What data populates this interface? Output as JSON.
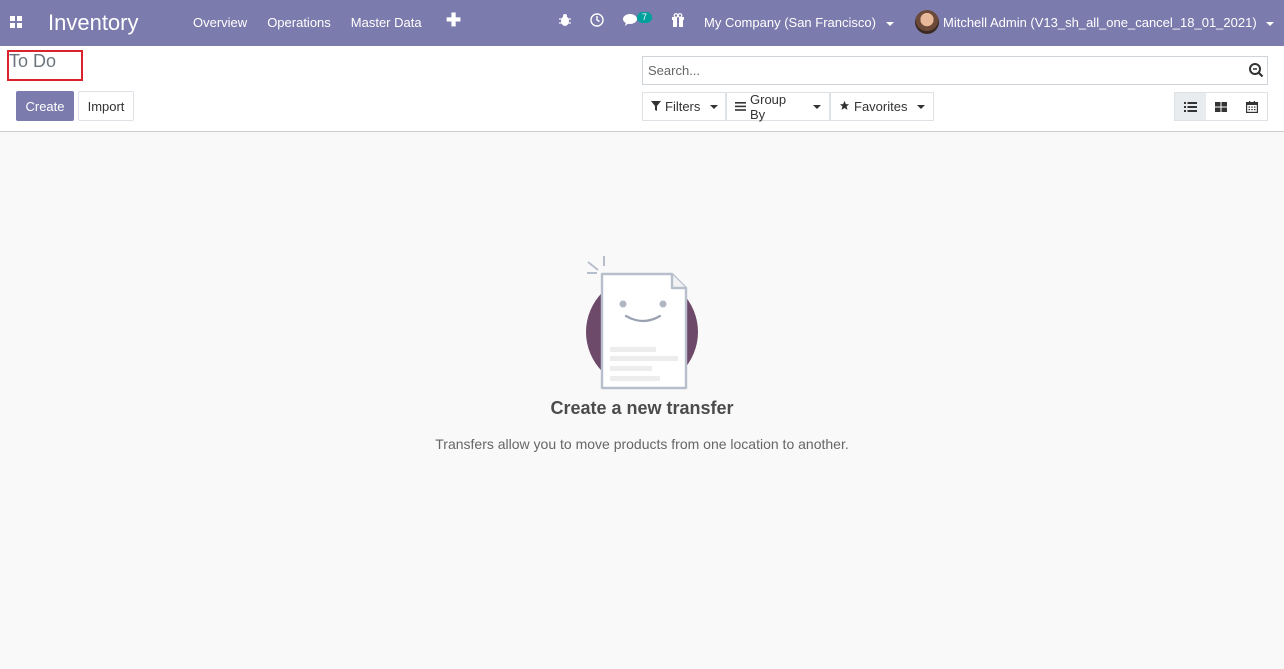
{
  "navbar": {
    "app_name": "Inventory",
    "menu": [
      "Overview",
      "Operations",
      "Master Data"
    ],
    "plus": "✚",
    "messages_count": "7",
    "company": "My Company (San Francisco)",
    "user": "Mitchell Admin (V13_sh_all_one_cancel_18_01_2021)"
  },
  "control_panel": {
    "breadcrumb": "To Do",
    "create_label": "Create",
    "import_label": "Import",
    "search_placeholder": "Search...",
    "filters_label": "Filters",
    "group_by_label": "Group By",
    "favorites_label": "Favorites"
  },
  "empty_state": {
    "title": "Create a new transfer",
    "description": "Transfers allow you to move products from one location to another."
  },
  "colors": {
    "brand": "#7c7bad",
    "badge": "#00a09d",
    "illustration_circle": "#6e4a6a"
  }
}
